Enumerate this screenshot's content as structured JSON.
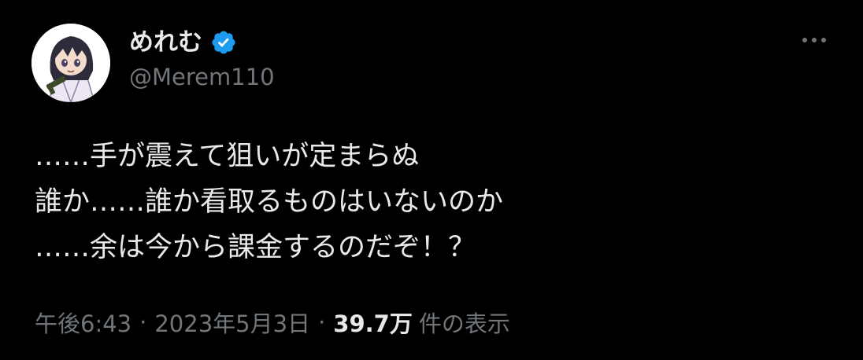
{
  "author": {
    "display_name": "めれむ",
    "handle": "@Merem110",
    "verified": true
  },
  "tweet": {
    "lines": [
      "……手が震えて狙いが定まらぬ",
      "誰か……誰か看取るものはいないのか",
      "……余は今から課金するのだぞ！？"
    ]
  },
  "meta": {
    "time": "午後6:43",
    "separator": "·",
    "date": "2023年5月3日",
    "views_count": "39.7万",
    "views_label": "件の表示"
  },
  "icons": {
    "verified": "verified-badge-icon",
    "more": "more-options-icon"
  },
  "colors": {
    "background": "#000000",
    "text_primary": "#e7e9ea",
    "text_secondary": "#71767b",
    "verified_blue": "#1d9bf0"
  }
}
